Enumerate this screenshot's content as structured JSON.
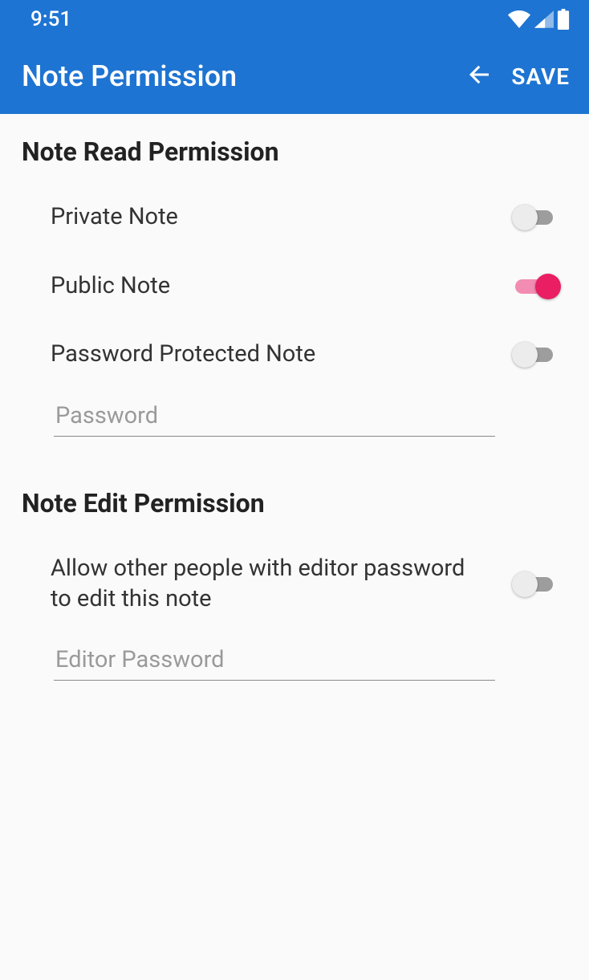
{
  "status": {
    "time": "9:51"
  },
  "appbar": {
    "title": "Note Permission",
    "save_label": "SAVE"
  },
  "read_section": {
    "title": "Note Read Permission",
    "private_label": "Private Note",
    "private_on": false,
    "public_label": "Public Note",
    "public_on": true,
    "pwprotect_label": "Password Protected Note",
    "pwprotect_on": false,
    "password_placeholder": "Password",
    "password_value": ""
  },
  "edit_section": {
    "title": "Note Edit Permission",
    "allow_label": "Allow other people with editor password to edit this note",
    "allow_on": false,
    "editor_password_placeholder": "Editor Password",
    "editor_password_value": ""
  },
  "colors": {
    "primary": "#1e74d2",
    "accent": "#e91e63"
  }
}
